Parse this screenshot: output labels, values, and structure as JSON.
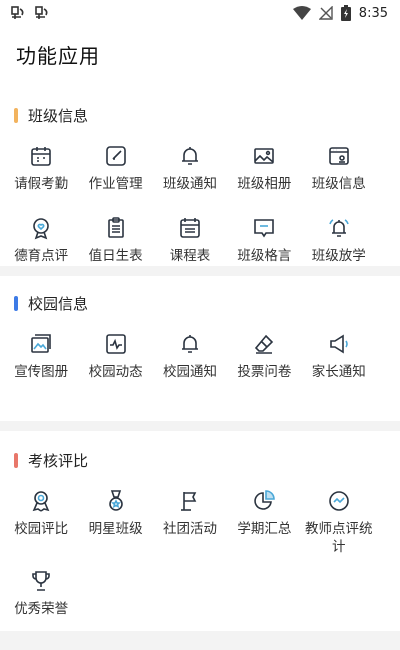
{
  "status_bar": {
    "time": "8:35",
    "left_icons": [
      "app-notification-icon",
      "app-notification-icon"
    ],
    "right_icons": [
      "wifi-icon",
      "no-signal-icon",
      "battery-charging-icon"
    ]
  },
  "header": {
    "title": "功能应用"
  },
  "sections": [
    {
      "title": "班级信息",
      "accent": "#f2b35e",
      "items": [
        {
          "label": "请假考勤",
          "icon": "calendar-icon"
        },
        {
          "label": "作业管理",
          "icon": "edit-icon"
        },
        {
          "label": "班级通知",
          "icon": "bell-icon"
        },
        {
          "label": "班级相册",
          "icon": "image-icon"
        },
        {
          "label": "班级信息",
          "icon": "info-card-icon"
        },
        {
          "label": "德育点评",
          "icon": "heart-badge-icon"
        },
        {
          "label": "值日生表",
          "icon": "clipboard-icon"
        },
        {
          "label": "课程表",
          "icon": "schedule-icon"
        },
        {
          "label": "班级格言",
          "icon": "message-icon"
        },
        {
          "label": "班级放学",
          "icon": "bell-ring-icon"
        }
      ]
    },
    {
      "title": "校园信息",
      "accent": "#3d7be6",
      "items": [
        {
          "label": "宣传图册",
          "icon": "gallery-icon"
        },
        {
          "label": "校园动态",
          "icon": "activity-icon"
        },
        {
          "label": "校园通知",
          "icon": "bell-icon"
        },
        {
          "label": "投票问卷",
          "icon": "eraser-icon"
        },
        {
          "label": "家长通知",
          "icon": "megaphone-icon"
        }
      ]
    },
    {
      "title": "考核评比",
      "accent": "#e8776a",
      "items": [
        {
          "label": "校园评比",
          "icon": "award-icon"
        },
        {
          "label": "明星班级",
          "icon": "medal-icon"
        },
        {
          "label": "社团活动",
          "icon": "flag-icon"
        },
        {
          "label": "学期汇总",
          "icon": "pie-chart-icon"
        },
        {
          "label": "教师点评统计",
          "icon": "trend-circle-icon"
        },
        {
          "label": "优秀荣誉",
          "icon": "trophy-icon"
        }
      ]
    }
  ]
}
